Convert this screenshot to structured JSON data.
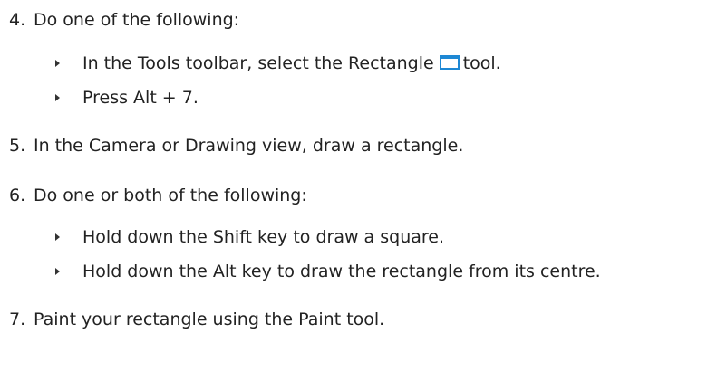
{
  "steps": [
    {
      "number": "4.",
      "text": "Do one of the following:",
      "bullets": [
        {
          "before_icon": "In the Tools toolbar, select the Rectangle",
          "icon": "rectangle-tool-icon",
          "after_icon": "tool."
        },
        {
          "text": "Press Alt + 7."
        }
      ]
    },
    {
      "number": "5.",
      "text": "In the Camera or Drawing view, draw a rectangle."
    },
    {
      "number": "6.",
      "text": "Do one or both of the following:",
      "bullets": [
        {
          "text": "Hold down the Shift key to draw a square."
        },
        {
          "text": "Hold down the Alt key to draw the rectangle from its centre."
        }
      ]
    },
    {
      "number": "7.",
      "text": "Paint your rectangle using the Paint tool."
    }
  ],
  "colors": {
    "text": "#222222",
    "icon_fill": "#1e88d4"
  }
}
